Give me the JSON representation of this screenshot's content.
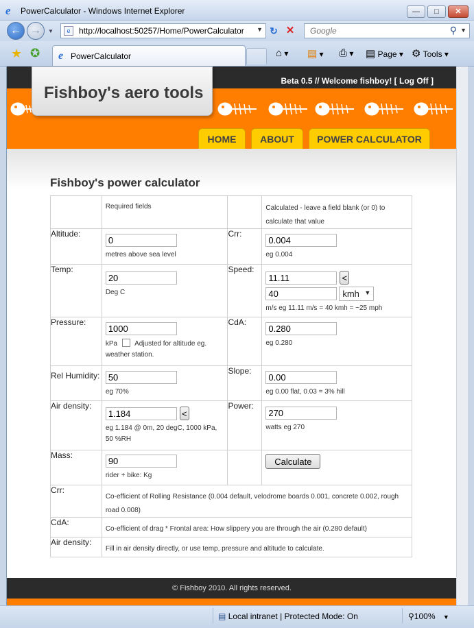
{
  "browser": {
    "window_title": "PowerCalculator - Windows Internet Explorer",
    "address": "http://localhost:50257/Home/PowerCalculator",
    "search_placeholder": "Google",
    "tab_title": "PowerCalculator",
    "toolbar": {
      "page_label": "Page",
      "tools_label": "Tools"
    },
    "status": {
      "zone": "Local intranet | Protected Mode: On",
      "zoom": "100%"
    }
  },
  "site": {
    "title": "Fishboy's aero tools",
    "login": {
      "prefix": "Beta 0.5 // Welcome fishboy! [ ",
      "logoff": "Log Off",
      "suffix": " ]"
    },
    "nav": {
      "home": "HOME",
      "about": "ABOUT",
      "calc": "POWER CALCULATOR"
    },
    "footer": "© Fishboy 2010. All rights reserved."
  },
  "calc": {
    "heading": "Fishboy's power calculator",
    "hdr_required": "Required fields",
    "hdr_calculated": "Calculated - leave a field blank (or 0) to calculate that value",
    "altitude": {
      "label": "Altitude:",
      "value": "0",
      "hint": "metres above sea level"
    },
    "crr": {
      "label": "Crr:",
      "value": "0.004",
      "hint": "eg 0.004"
    },
    "temp": {
      "label": "Temp:",
      "value": "20",
      "hint": "Deg C"
    },
    "speed": {
      "label": "Speed:",
      "value_ms": "11.11",
      "btn": "<",
      "value_unit": "40",
      "unit": "kmh",
      "hint": "m/s eg 11.11 m/s = 40 kmh = ~25 mph"
    },
    "pressure": {
      "label": "Pressure:",
      "value": "1000",
      "unit": "kPa",
      "hint": "Adjusted for altitude eg. weather station."
    },
    "cda": {
      "label": "CdA:",
      "value": "0.280",
      "hint": "eg 0.280"
    },
    "humidity": {
      "label": "Rel Humidity:",
      "value": "50",
      "hint": "eg 70%"
    },
    "slope": {
      "label": "Slope:",
      "value": "0.00",
      "hint": "eg 0.00 flat, 0.03 = 3% hill"
    },
    "density": {
      "label": "Air density:",
      "value": "1.184",
      "btn": "<",
      "hint": "eg 1.184 @ 0m, 20 degC, 1000 kPa, 50 %RH"
    },
    "power": {
      "label": "Power:",
      "value": "270",
      "hint": "watts eg 270"
    },
    "mass": {
      "label": "Mass:",
      "value": "90",
      "hint": "rider + bike: Kg"
    },
    "calculate": "Calculate",
    "notes": [
      {
        "term": "Crr:",
        "desc": "Co-efficient of Rolling Resistance (0.004 default, velodrome boards 0.001, concrete 0.002, rough road 0.008)"
      },
      {
        "term": "CdA:",
        "desc": "Co-efficient of drag * Frontal area: How slippery you are through the air (0.280 default)"
      },
      {
        "term": "Air density:",
        "desc": "Fill in air density directly, or use temp, pressure and altitude to calculate."
      }
    ]
  }
}
